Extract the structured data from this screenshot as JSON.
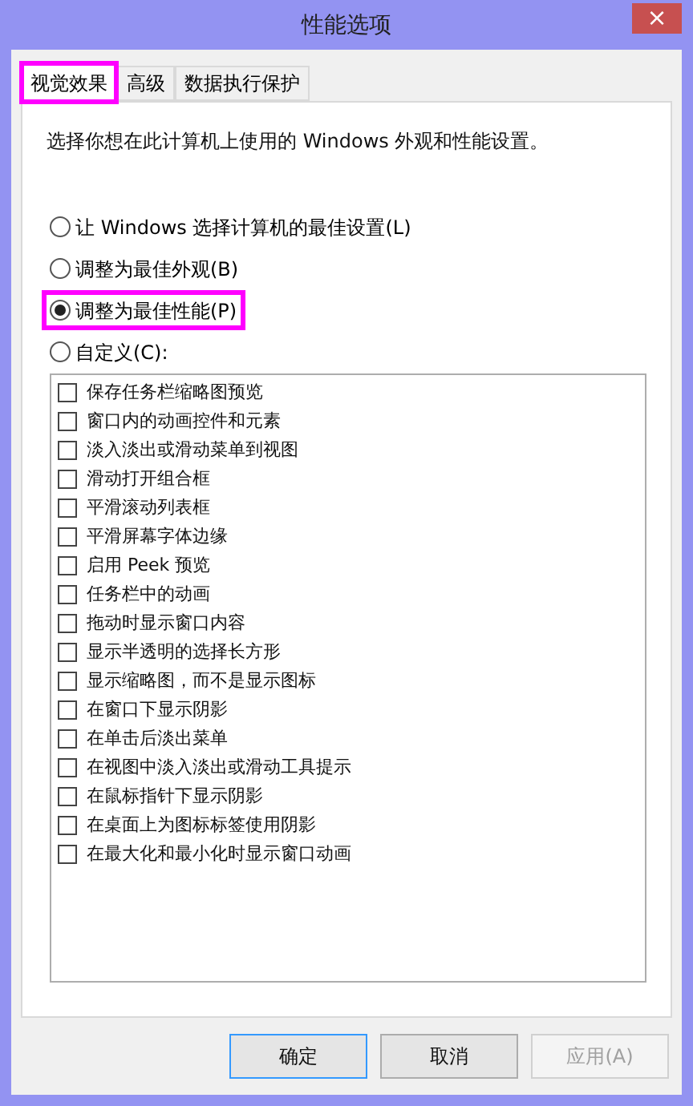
{
  "window": {
    "title": "性能选项",
    "close": "×"
  },
  "tabs": [
    {
      "label": "视觉效果",
      "selected": true,
      "highlighted": true
    },
    {
      "label": "高级",
      "selected": false,
      "highlighted": false
    },
    {
      "label": "数据执行保护",
      "selected": false,
      "highlighted": false
    }
  ],
  "description": "选择你想在此计算机上使用的 Windows 外观和性能设置。",
  "options": [
    {
      "label": "让 Windows 选择计算机的最佳设置(L)",
      "selected": false,
      "highlighted": false
    },
    {
      "label": "调整为最佳外观(B)",
      "selected": false,
      "highlighted": false
    },
    {
      "label": "调整为最佳性能(P)",
      "selected": true,
      "highlighted": true
    },
    {
      "label": "自定义(C):",
      "selected": false,
      "highlighted": false
    }
  ],
  "effects": [
    {
      "label": "保存任务栏缩略图预览",
      "checked": false
    },
    {
      "label": "窗口内的动画控件和元素",
      "checked": false
    },
    {
      "label": "淡入淡出或滑动菜单到视图",
      "checked": false
    },
    {
      "label": "滑动打开组合框",
      "checked": false
    },
    {
      "label": "平滑滚动列表框",
      "checked": false
    },
    {
      "label": "平滑屏幕字体边缘",
      "checked": false
    },
    {
      "label": "启用 Peek 预览",
      "checked": false
    },
    {
      "label": "任务栏中的动画",
      "checked": false
    },
    {
      "label": "拖动时显示窗口内容",
      "checked": false
    },
    {
      "label": "显示半透明的选择长方形",
      "checked": false
    },
    {
      "label": "显示缩略图，而不是显示图标",
      "checked": false
    },
    {
      "label": "在窗口下显示阴影",
      "checked": false
    },
    {
      "label": "在单击后淡出菜单",
      "checked": false
    },
    {
      "label": "在视图中淡入淡出或滑动工具提示",
      "checked": false
    },
    {
      "label": "在鼠标指针下显示阴影",
      "checked": false
    },
    {
      "label": "在桌面上为图标标签使用阴影",
      "checked": false
    },
    {
      "label": "在最大化和最小化时显示窗口动画",
      "checked": false
    }
  ],
  "buttons": [
    {
      "label": "确定",
      "default": true,
      "disabled": false
    },
    {
      "label": "取消",
      "default": false,
      "disabled": false
    },
    {
      "label": "应用(A)",
      "default": false,
      "disabled": true
    }
  ]
}
